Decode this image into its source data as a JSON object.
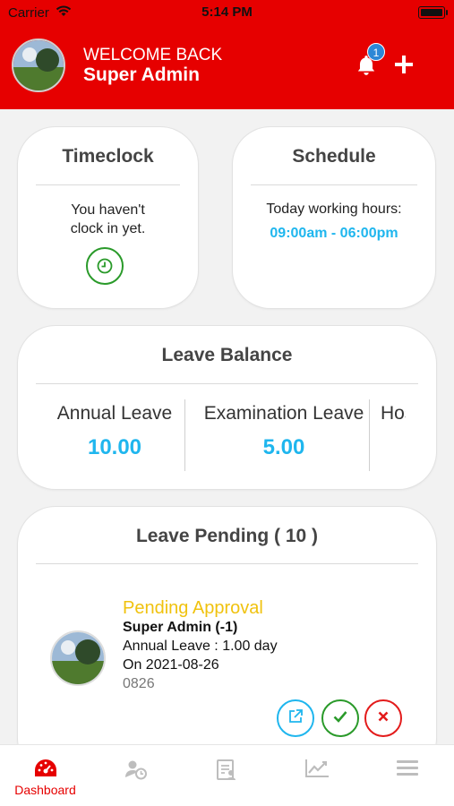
{
  "status_bar": {
    "carrier": "Carrier",
    "time": "5:14 PM"
  },
  "header": {
    "welcome": "WELCOME BACK",
    "user_name": "Super Admin",
    "notification_count": "1"
  },
  "timeclock": {
    "title": "Timeclock",
    "line1": "You haven't",
    "line2": "clock in yet."
  },
  "schedule": {
    "title": "Schedule",
    "label": "Today working hours:",
    "hours": "09:00am - 06:00pm"
  },
  "leave_balance": {
    "title": "Leave Balance",
    "items": [
      {
        "name": "Annual Leave",
        "value": "10.00"
      },
      {
        "name": "Examination Leave",
        "value": "5.00"
      },
      {
        "name": "Hos"
      }
    ]
  },
  "leave_pending": {
    "title": "Leave Pending ( 10 )",
    "item": {
      "status": "Pending Approval",
      "name": "Super Admin (-1)",
      "type": "Annual Leave : 1.00 day",
      "date": "On 2021-08-26",
      "code": "0826"
    }
  },
  "tabbar": {
    "active_label": "Dashboard"
  },
  "colors": {
    "brand_red": "#e60000",
    "accent_blue": "#1fb6ee",
    "pending_yellow": "#f0c20e",
    "approve_green": "#2a9a2a"
  }
}
